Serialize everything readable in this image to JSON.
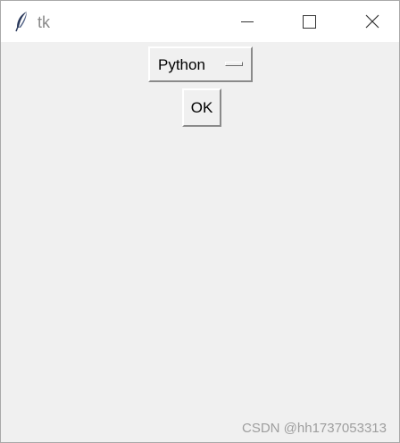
{
  "window": {
    "title": "tk",
    "app_icon": "feather-icon",
    "controls": {
      "minimize_icon": "minimize-icon",
      "maximize_icon": "maximize-icon",
      "close_icon": "close-icon"
    }
  },
  "content": {
    "option_menu": {
      "selected_value": "Python",
      "indicator_icon": "option-indicator-icon"
    },
    "ok_button_label": "OK"
  },
  "watermark": "CSDN @hh1737053313",
  "colors": {
    "window_background": "#f0f0f0",
    "titlebar_background": "#ffffff",
    "title_text": "#8a8a8a",
    "watermark_text": "#9e9e9e"
  }
}
